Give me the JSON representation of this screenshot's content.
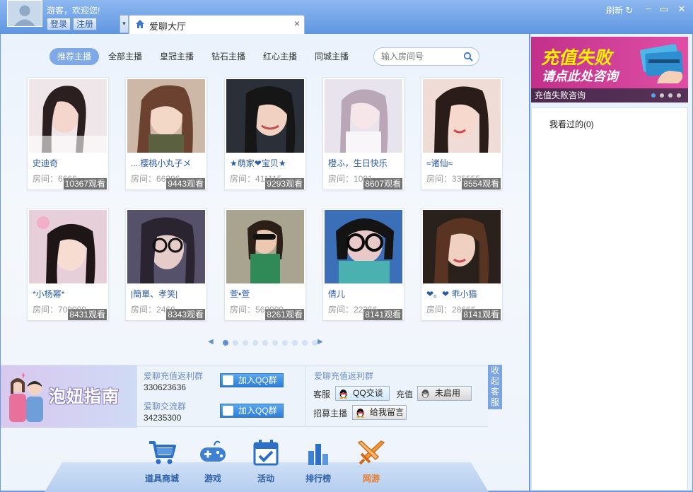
{
  "header": {
    "greeting": "游客，欢迎您!",
    "login_label": "登录",
    "register_label": "注册",
    "tab_title": "爱聊大厅",
    "tab_close": "×",
    "refresh_label": "刷新",
    "window_buttons": [
      "minimize",
      "maximize",
      "close"
    ]
  },
  "filters": [
    "推荐主播",
    "全部主播",
    "皇冠主播",
    "钻石主播",
    "红心主播",
    "同城主播"
  ],
  "active_filter": "推荐主播",
  "search": {
    "placeholder": "输入房间号"
  },
  "room_prefix": "房间：",
  "cards": [
    {
      "name": "史迪奇",
      "views": "10367观看",
      "room": "6666"
    },
    {
      "name": "....樱桃小丸子メ",
      "views": "9443观看",
      "room": "66386"
    },
    {
      "name": "★萌家❤宝贝★",
      "views": "9293观看",
      "room": "411115"
    },
    {
      "name": "橙ふ，生日快乐",
      "views": "8607观看",
      "room": "1001"
    },
    {
      "name": "≈诸仙≈",
      "views": "8554观看",
      "room": "335555"
    },
    {
      "name": "*小杨幂*",
      "views": "8431观看",
      "room": "709999"
    },
    {
      "name": "|簡單、孝笑|",
      "views": "8343观看",
      "room": "2468"
    },
    {
      "name": "萱•萱",
      "views": "8261观看",
      "room": "569999"
    },
    {
      "name": "倩儿",
      "views": "8141观看",
      "room": "22266"
    },
    {
      "name": "❤。❤ 乖小猫",
      "views": "8141观看",
      "room": "28666"
    }
  ],
  "pager": {
    "pages": 10,
    "current": 1
  },
  "guide": {
    "title": "泡妞指南"
  },
  "groups": [
    {
      "title": "爱聊充值返利群",
      "number": "330623636",
      "button": "加入QQ群"
    },
    {
      "title": "爱聊交流群",
      "number": "34235300",
      "button": "加入QQ群"
    }
  ],
  "service": {
    "title": "爱聊充值返利群",
    "kefu_label": "客服",
    "qq_chat": "QQ交谈",
    "recharge_label": "充值",
    "not_enabled": "未启用",
    "recruit_label": "招募主播",
    "leave_msg": "给我留言"
  },
  "collapse_label": "收起客服",
  "nav": [
    {
      "label": "道具商城",
      "icon": "cart-icon"
    },
    {
      "label": "游戏",
      "icon": "gamepad-icon"
    },
    {
      "label": "活动",
      "icon": "calendar-icon"
    },
    {
      "label": "排行榜",
      "icon": "bar-chart-icon"
    },
    {
      "label": "网游",
      "icon": "sword-icon"
    }
  ],
  "banner": {
    "line1": "充值失败",
    "line2": "请点此处咨询",
    "caption": "充值失败咨询"
  },
  "history": {
    "label": "我看过的(0)"
  },
  "colors": {
    "accent": "#5f95e0",
    "link": "#2a5aa0",
    "nav_hot": "#e87a2a",
    "banner": "#d0409a"
  }
}
